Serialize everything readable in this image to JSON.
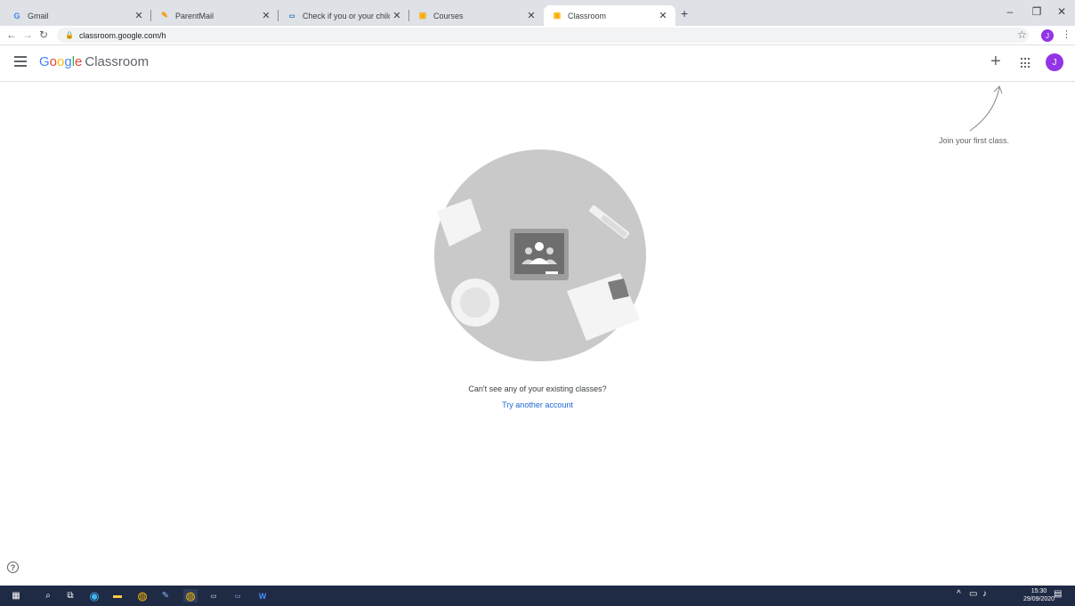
{
  "browser": {
    "tabs": [
      {
        "title": "Gmail",
        "favicon": "gmail-icon",
        "favicon_color": "#ea4335"
      },
      {
        "title": "ParentMail",
        "favicon": "parentmail-icon",
        "favicon_color": "#f29900"
      },
      {
        "title": "Check if you or your child has co",
        "favicon": "nhs-icon",
        "favicon_color": "#005eb8"
      },
      {
        "title": "Courses",
        "favicon": "classroom-icon",
        "favicon_color": "#f9ab00"
      },
      {
        "title": "Classroom",
        "favicon": "classroom-icon",
        "favicon_color": "#f9ab00",
        "active": true
      }
    ],
    "url": "classroom.google.com/h",
    "profile_initial": "J"
  },
  "header": {
    "brand_google": "Google",
    "brand_product": "Classroom",
    "avatar_initial": "J",
    "avatar_color": "#9334e6"
  },
  "hint": {
    "text": "Join your first class."
  },
  "main": {
    "message": "Can't see any of your existing classes?",
    "link": "Try another account"
  },
  "taskbar": {
    "time": "15:30",
    "date": "29/09/2020"
  }
}
